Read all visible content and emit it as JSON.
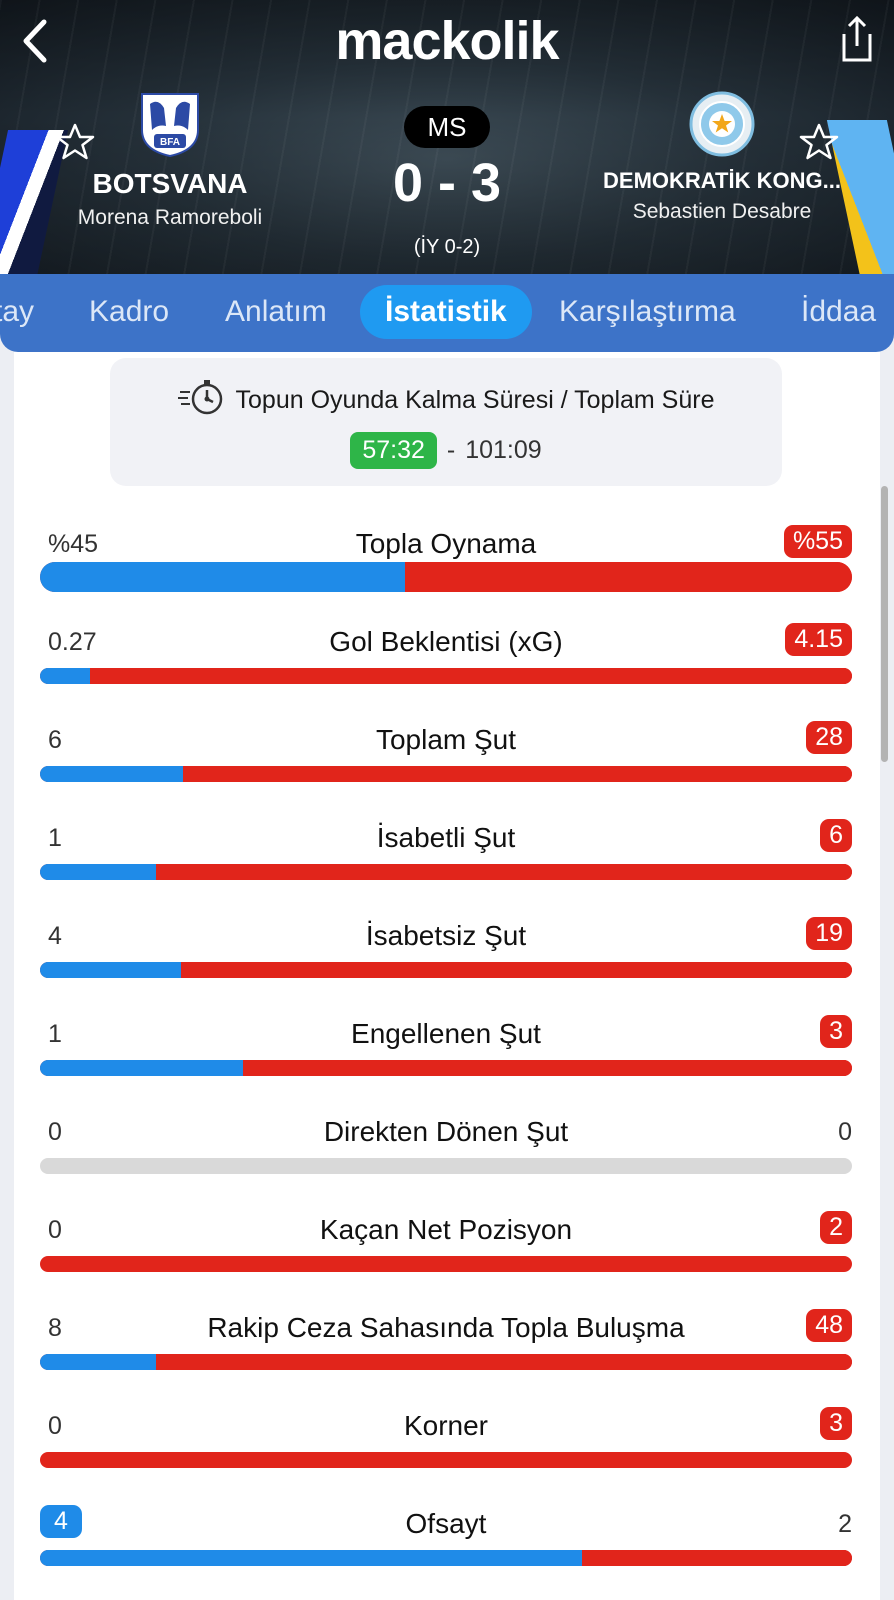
{
  "header": {
    "brand": "mackolik",
    "status": "MS",
    "score": "0 - 3",
    "half_time": "(İY 0-2)",
    "home": {
      "name": "BOTSVANA",
      "coach": "Morena Ramoreboli",
      "crest_text": "BFA"
    },
    "away": {
      "name": "DEMOKRATİK KONG...",
      "coach": "Sebastien Desabre"
    }
  },
  "tabs": [
    {
      "label": "tay"
    },
    {
      "label": "Kadro"
    },
    {
      "label": "Anlatım"
    },
    {
      "label": "İstatistik",
      "active": true
    },
    {
      "label": "Karşılaştırma"
    },
    {
      "label": "İddaa"
    }
  ],
  "ball_in_play": {
    "title": "Topun Oyunda Kalma Süresi / Toplam Süre",
    "in_play": "57:32",
    "separator": "-",
    "total": "101:09"
  },
  "stats": [
    {
      "label": "Topla Oynama",
      "home": "%45",
      "away": "%55",
      "home_share": 0.45,
      "highlight": "away"
    },
    {
      "label": "Gol Beklentisi (xG)",
      "home": "0.27",
      "away": "4.15",
      "home_share": 0.061,
      "highlight": "away"
    },
    {
      "label": "Toplam Şut",
      "home": "6",
      "away": "28",
      "home_share": 0.176,
      "highlight": "away"
    },
    {
      "label": "İsabetli Şut",
      "home": "1",
      "away": "6",
      "home_share": 0.143,
      "highlight": "away"
    },
    {
      "label": "İsabetsiz Şut",
      "home": "4",
      "away": "19",
      "home_share": 0.174,
      "highlight": "away"
    },
    {
      "label": "Engellenen Şut",
      "home": "1",
      "away": "3",
      "home_share": 0.25,
      "highlight": "away"
    },
    {
      "label": "Direkten Dönen Şut",
      "home": "0",
      "away": "0",
      "home_share": 0,
      "highlight": "none"
    },
    {
      "label": "Kaçan Net Pozisyon",
      "home": "0",
      "away": "2",
      "home_share": 0,
      "highlight": "away"
    },
    {
      "label": "Rakip Ceza Sahasında Topla Buluşma",
      "home": "8",
      "away": "48",
      "home_share": 0.143,
      "highlight": "away"
    },
    {
      "label": "Korner",
      "home": "0",
      "away": "3",
      "home_share": 0,
      "highlight": "away"
    },
    {
      "label": "Ofsayt",
      "home": "4",
      "away": "2",
      "home_share": 0.667,
      "highlight": "home"
    }
  ],
  "colors": {
    "home_bar": "#1f8be8",
    "away_bar": "#e1251b",
    "tab_bar": "#3d73c8",
    "tab_active": "#1f9af1",
    "in_play_badge": "#2eb548"
  },
  "icons": {
    "back": "back-arrow-icon",
    "share": "share-icon",
    "favorite": "star-icon",
    "ball_timer": "stopwatch-ball-icon"
  }
}
